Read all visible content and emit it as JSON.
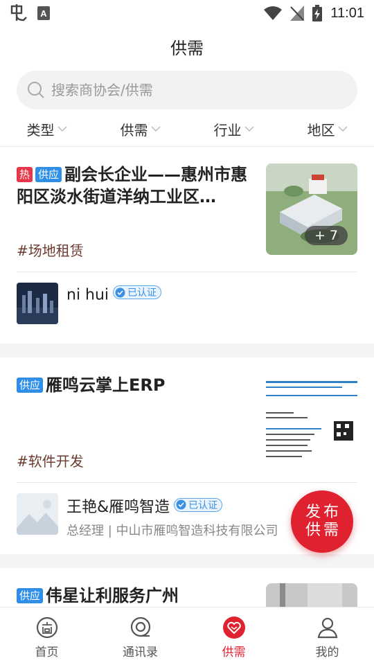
{
  "status_bar": {
    "time": "11:01"
  },
  "header": {
    "title": "供需"
  },
  "search": {
    "placeholder": "搜索商协会/供需"
  },
  "filters": [
    "类型",
    "供需",
    "行业",
    "地区"
  ],
  "cards": [
    {
      "tags": [
        "热",
        "供应"
      ],
      "title": "副会长企业——惠州市惠阳区淡水街道洋纳工业区…",
      "hashtag": "#场地租赁",
      "image_count": "+ 7",
      "author": {
        "name": "ni hui",
        "verified": "已认证"
      }
    },
    {
      "tags": [
        "供应"
      ],
      "title": "雁鸣云掌上ERP",
      "hashtag": "#软件开发",
      "author": {
        "name": "王艳&雁鸣智造",
        "verified": "已认证",
        "subtitle": "总经理 | 中山市雁鸣智造科技有限公司"
      }
    },
    {
      "tags": [
        "供应"
      ],
      "title": "伟星让利服务广州"
    }
  ],
  "fab": {
    "line1": "发布",
    "line2": "供需"
  },
  "bottom_nav": [
    {
      "label": "首页",
      "icon": "home-icon"
    },
    {
      "label": "通讯录",
      "icon": "contacts-icon"
    },
    {
      "label": "供需",
      "icon": "heart-icon",
      "active": true
    },
    {
      "label": "我的",
      "icon": "profile-icon"
    }
  ],
  "colors": {
    "accent": "#e0212f",
    "supply_tag": "#2f8fe8",
    "hot_tag": "#e8364a",
    "hashtag": "#6b3a2e"
  }
}
